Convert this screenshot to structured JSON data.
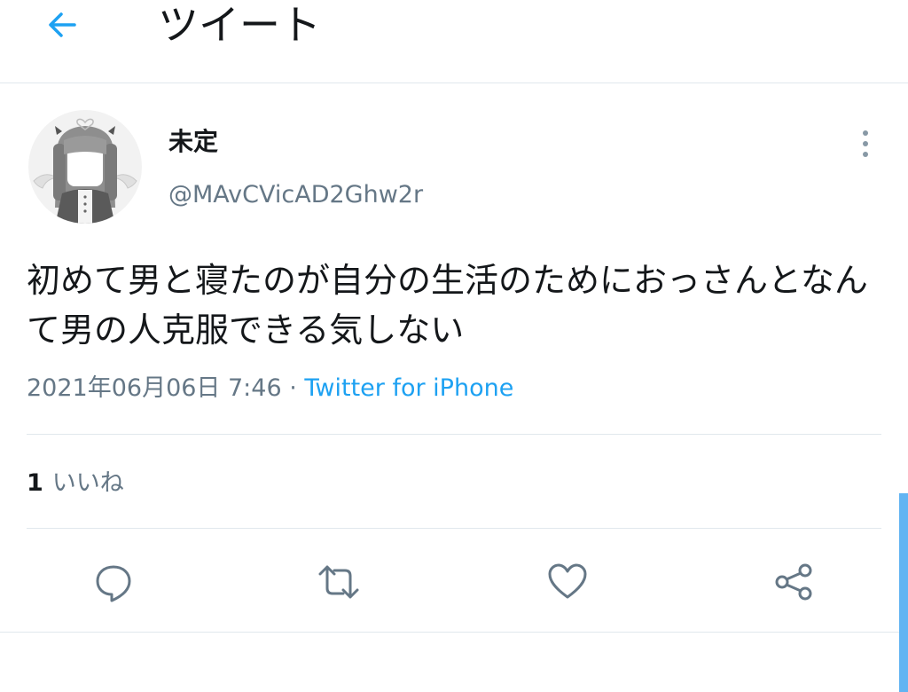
{
  "header": {
    "back_icon": "arrow-left-icon",
    "title": "ツイート"
  },
  "tweet": {
    "avatar_icon": "avatar-illustration",
    "display_name": "未定",
    "handle": "@MAvCVicAD2Ghw2r",
    "more_icon": "vertical-ellipsis-icon",
    "text": "初めて男と寝たのが自分の生活のためにおっさんとなんて男の人克服できる気しない",
    "timestamp": "2021年06月06日 7:46",
    "separator": " · ",
    "source": "Twitter for iPhone",
    "likes_count": "1",
    "likes_label": "いいね"
  },
  "actions": [
    {
      "icon": "reply-icon"
    },
    {
      "icon": "retweet-icon"
    },
    {
      "icon": "like-icon"
    },
    {
      "icon": "share-icon"
    }
  ],
  "colors": {
    "accent": "#1da1f2",
    "secondary_text": "#657786",
    "divider": "#e1e8ed",
    "scrollbar": "#62b4f2"
  }
}
